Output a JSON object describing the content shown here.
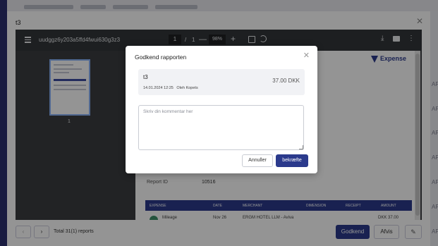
{
  "outer_dialog": {
    "title": "t3"
  },
  "pdf_viewer": {
    "doc_name": "uudggz6y203a5ffd4fwui630g3z3",
    "current_page": "1",
    "page_separator": "/",
    "total_pages": "1",
    "zoom": "98%",
    "thumbnail_label": "1"
  },
  "report_page": {
    "brand": "Expense",
    "report_id_label": "Report ID",
    "report_id_value": "10516",
    "table_headers": [
      "EXPENSE",
      "DATE",
      "MERCHANT",
      "DIMENSION",
      "RECEIPT",
      "AMOUNT"
    ],
    "row": {
      "expense": "Mileage",
      "date": "Nov 26",
      "merchant": "ERGM HOTEL LLM - Aviva",
      "amount": "DKK 37.00"
    }
  },
  "background": {
    "ap_label": "AP"
  },
  "footer": {
    "total_text": "Total 31(1) reports",
    "approve_label": "Godkend",
    "reject_label": "Afvis"
  },
  "modal": {
    "title": "Godkend rapporten",
    "report_name": "t3",
    "report_datetime": "14.01.2024 12:25",
    "report_owner": "Oleh Kopets",
    "amount": "37.00 DKK",
    "comment_placeholder": "Skriv din kommentar her",
    "comment_value": "",
    "cancel_label": "Annuller",
    "confirm_label": "bekræfte"
  },
  "colors": {
    "primary": "#2b3a8c",
    "viewer_toolbar": "#323639",
    "viewer_bg": "#3c3d40"
  }
}
